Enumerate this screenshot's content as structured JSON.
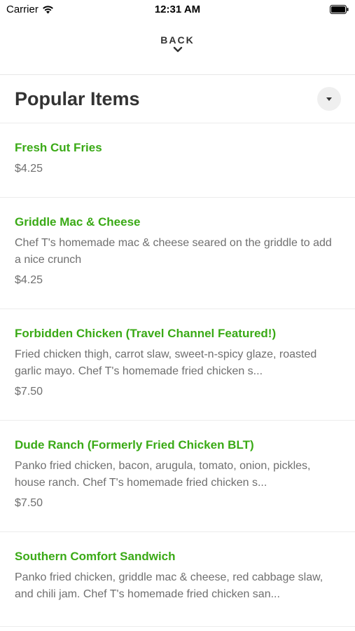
{
  "status_bar": {
    "carrier": "Carrier",
    "time": "12:31 AM"
  },
  "header": {
    "back_label": "BACK",
    "section_title": "Popular Items"
  },
  "icons": {
    "wifi": "wifi-icon",
    "battery": "battery-icon",
    "back_chevron": "chevron-down-icon",
    "dropdown": "caret-down-icon"
  },
  "colors": {
    "accent": "#3aaa16",
    "text": "#333333",
    "muted": "#6f6f6f",
    "divider": "#ececec"
  },
  "items": [
    {
      "name": "Fresh Cut Fries",
      "description": "",
      "price": "$4.25"
    },
    {
      "name": "Griddle Mac & Cheese",
      "description": "Chef T's homemade mac & cheese seared on the griddle to add a nice crunch",
      "price": "$4.25"
    },
    {
      "name": "Forbidden Chicken (Travel Channel Featured!)",
      "description": "Fried chicken thigh, carrot slaw, sweet-n-spicy glaze, roasted garlic mayo. Chef T's homemade fried chicken s...",
      "price": "$7.50"
    },
    {
      "name": "Dude Ranch (Formerly Fried Chicken BLT)",
      "description": "Panko fried chicken, bacon, arugula, tomato, onion, pickles, house ranch. Chef T's homemade fried chicken s...",
      "price": "$7.50"
    },
    {
      "name": "Southern Comfort Sandwich",
      "description": "Panko fried chicken, griddle mac & cheese, red cabbage slaw, and chili jam. Chef T's homemade fried chicken san...",
      "price": ""
    }
  ]
}
